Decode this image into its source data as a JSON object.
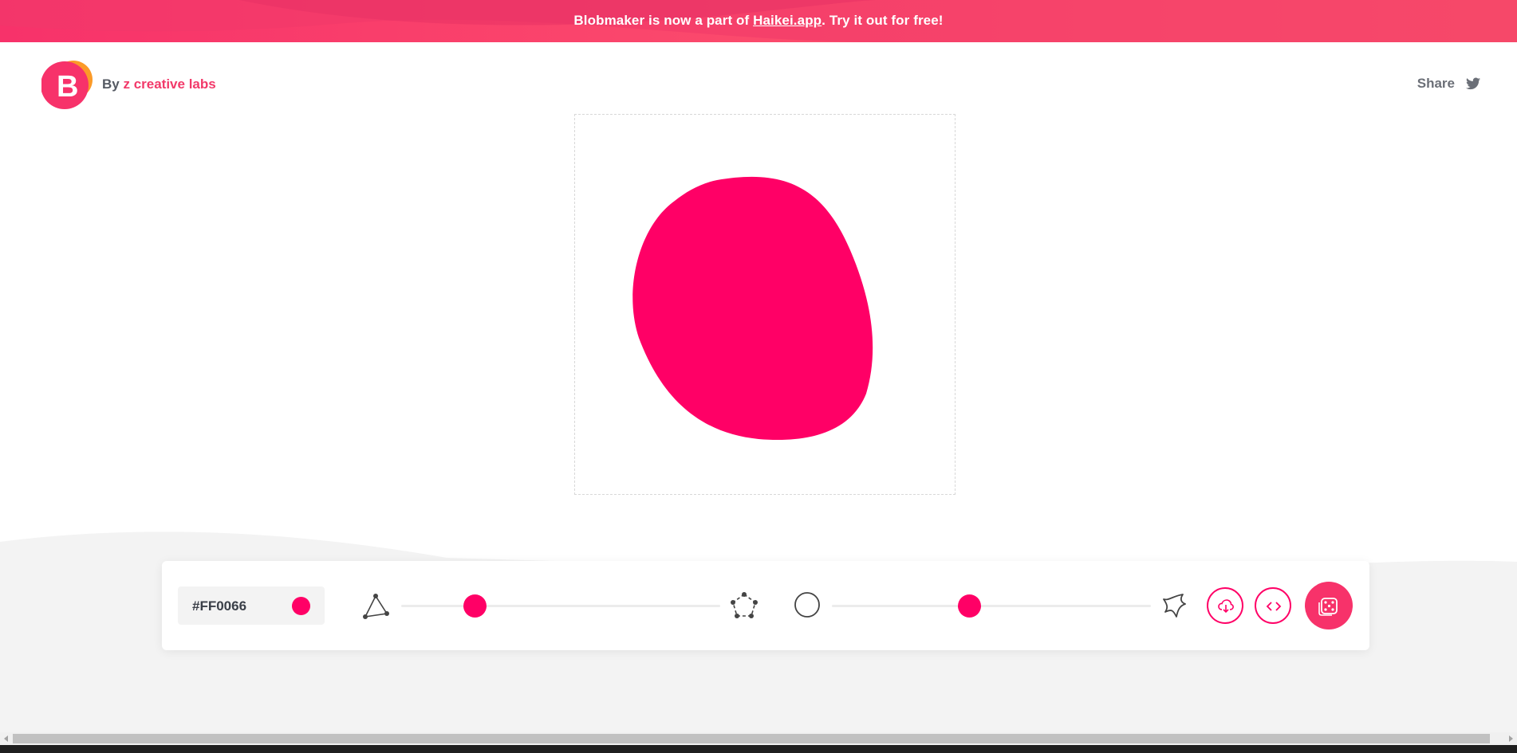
{
  "banner": {
    "text_before": "Blobmaker is now a part of ",
    "link": "Haikei.app",
    "text_after": ". Try it out for free!"
  },
  "header": {
    "logo_letter": "B",
    "by_label": "By ",
    "author_link": "z creative labs",
    "share_label": "Share"
  },
  "toolbar": {
    "color_value": "#FF0066",
    "complexity_slider": {
      "min_icon": "triangle-nodes-icon",
      "max_icon": "pentagon-nodes-icon",
      "value": 0.23
    },
    "contrast_slider": {
      "min_icon": "circle-outline-icon",
      "max_icon": "spiky-blob-icon",
      "value": 0.43
    },
    "buttons": [
      "download-icon",
      "code-icon",
      "dice-icon"
    ]
  },
  "colors": {
    "accent": "#ff0066",
    "banner": "#fb4a6c",
    "link": "#f23a6a",
    "background_bottom": "#f3f3f3"
  }
}
